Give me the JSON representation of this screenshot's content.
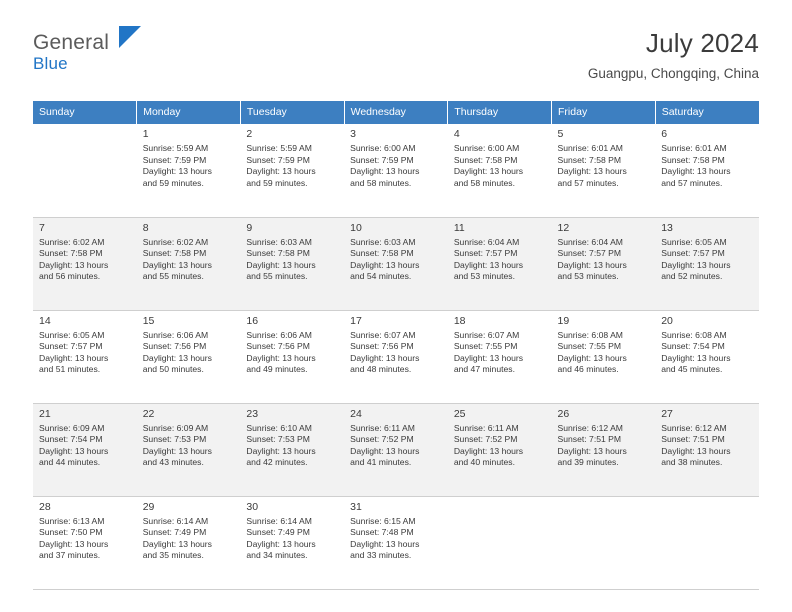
{
  "brand": {
    "general": "General",
    "blue": "Blue",
    "flag_icon": "flag-icon"
  },
  "header": {
    "title": "July 2024",
    "subtitle": "Guangpu, Chongqing, China"
  },
  "calendar": {
    "weekdays": [
      "Sunday",
      "Monday",
      "Tuesday",
      "Wednesday",
      "Thursday",
      "Friday",
      "Saturday"
    ],
    "weeks": [
      [
        {
          "day": "",
          "detail": ""
        },
        {
          "day": "1",
          "detail": "Sunrise: 5:59 AM\nSunset: 7:59 PM\nDaylight: 13 hours\nand 59 minutes."
        },
        {
          "day": "2",
          "detail": "Sunrise: 5:59 AM\nSunset: 7:59 PM\nDaylight: 13 hours\nand 59 minutes."
        },
        {
          "day": "3",
          "detail": "Sunrise: 6:00 AM\nSunset: 7:59 PM\nDaylight: 13 hours\nand 58 minutes."
        },
        {
          "day": "4",
          "detail": "Sunrise: 6:00 AM\nSunset: 7:58 PM\nDaylight: 13 hours\nand 58 minutes."
        },
        {
          "day": "5",
          "detail": "Sunrise: 6:01 AM\nSunset: 7:58 PM\nDaylight: 13 hours\nand 57 minutes."
        },
        {
          "day": "6",
          "detail": "Sunrise: 6:01 AM\nSunset: 7:58 PM\nDaylight: 13 hours\nand 57 minutes."
        }
      ],
      [
        {
          "day": "7",
          "detail": "Sunrise: 6:02 AM\nSunset: 7:58 PM\nDaylight: 13 hours\nand 56 minutes."
        },
        {
          "day": "8",
          "detail": "Sunrise: 6:02 AM\nSunset: 7:58 PM\nDaylight: 13 hours\nand 55 minutes."
        },
        {
          "day": "9",
          "detail": "Sunrise: 6:03 AM\nSunset: 7:58 PM\nDaylight: 13 hours\nand 55 minutes."
        },
        {
          "day": "10",
          "detail": "Sunrise: 6:03 AM\nSunset: 7:58 PM\nDaylight: 13 hours\nand 54 minutes."
        },
        {
          "day": "11",
          "detail": "Sunrise: 6:04 AM\nSunset: 7:57 PM\nDaylight: 13 hours\nand 53 minutes."
        },
        {
          "day": "12",
          "detail": "Sunrise: 6:04 AM\nSunset: 7:57 PM\nDaylight: 13 hours\nand 53 minutes."
        },
        {
          "day": "13",
          "detail": "Sunrise: 6:05 AM\nSunset: 7:57 PM\nDaylight: 13 hours\nand 52 minutes."
        }
      ],
      [
        {
          "day": "14",
          "detail": "Sunrise: 6:05 AM\nSunset: 7:57 PM\nDaylight: 13 hours\nand 51 minutes."
        },
        {
          "day": "15",
          "detail": "Sunrise: 6:06 AM\nSunset: 7:56 PM\nDaylight: 13 hours\nand 50 minutes."
        },
        {
          "day": "16",
          "detail": "Sunrise: 6:06 AM\nSunset: 7:56 PM\nDaylight: 13 hours\nand 49 minutes."
        },
        {
          "day": "17",
          "detail": "Sunrise: 6:07 AM\nSunset: 7:56 PM\nDaylight: 13 hours\nand 48 minutes."
        },
        {
          "day": "18",
          "detail": "Sunrise: 6:07 AM\nSunset: 7:55 PM\nDaylight: 13 hours\nand 47 minutes."
        },
        {
          "day": "19",
          "detail": "Sunrise: 6:08 AM\nSunset: 7:55 PM\nDaylight: 13 hours\nand 46 minutes."
        },
        {
          "day": "20",
          "detail": "Sunrise: 6:08 AM\nSunset: 7:54 PM\nDaylight: 13 hours\nand 45 minutes."
        }
      ],
      [
        {
          "day": "21",
          "detail": "Sunrise: 6:09 AM\nSunset: 7:54 PM\nDaylight: 13 hours\nand 44 minutes."
        },
        {
          "day": "22",
          "detail": "Sunrise: 6:09 AM\nSunset: 7:53 PM\nDaylight: 13 hours\nand 43 minutes."
        },
        {
          "day": "23",
          "detail": "Sunrise: 6:10 AM\nSunset: 7:53 PM\nDaylight: 13 hours\nand 42 minutes."
        },
        {
          "day": "24",
          "detail": "Sunrise: 6:11 AM\nSunset: 7:52 PM\nDaylight: 13 hours\nand 41 minutes."
        },
        {
          "day": "25",
          "detail": "Sunrise: 6:11 AM\nSunset: 7:52 PM\nDaylight: 13 hours\nand 40 minutes."
        },
        {
          "day": "26",
          "detail": "Sunrise: 6:12 AM\nSunset: 7:51 PM\nDaylight: 13 hours\nand 39 minutes."
        },
        {
          "day": "27",
          "detail": "Sunrise: 6:12 AM\nSunset: 7:51 PM\nDaylight: 13 hours\nand 38 minutes."
        }
      ],
      [
        {
          "day": "28",
          "detail": "Sunrise: 6:13 AM\nSunset: 7:50 PM\nDaylight: 13 hours\nand 37 minutes."
        },
        {
          "day": "29",
          "detail": "Sunrise: 6:14 AM\nSunset: 7:49 PM\nDaylight: 13 hours\nand 35 minutes."
        },
        {
          "day": "30",
          "detail": "Sunrise: 6:14 AM\nSunset: 7:49 PM\nDaylight: 13 hours\nand 34 minutes."
        },
        {
          "day": "31",
          "detail": "Sunrise: 6:15 AM\nSunset: 7:48 PM\nDaylight: 13 hours\nand 33 minutes."
        },
        {
          "day": "",
          "detail": ""
        },
        {
          "day": "",
          "detail": ""
        },
        {
          "day": "",
          "detail": ""
        }
      ]
    ]
  },
  "colors": {
    "header_blue": "#3d7fc1",
    "brand_blue": "#2175c6",
    "alt_row": "#f2f2f2"
  }
}
